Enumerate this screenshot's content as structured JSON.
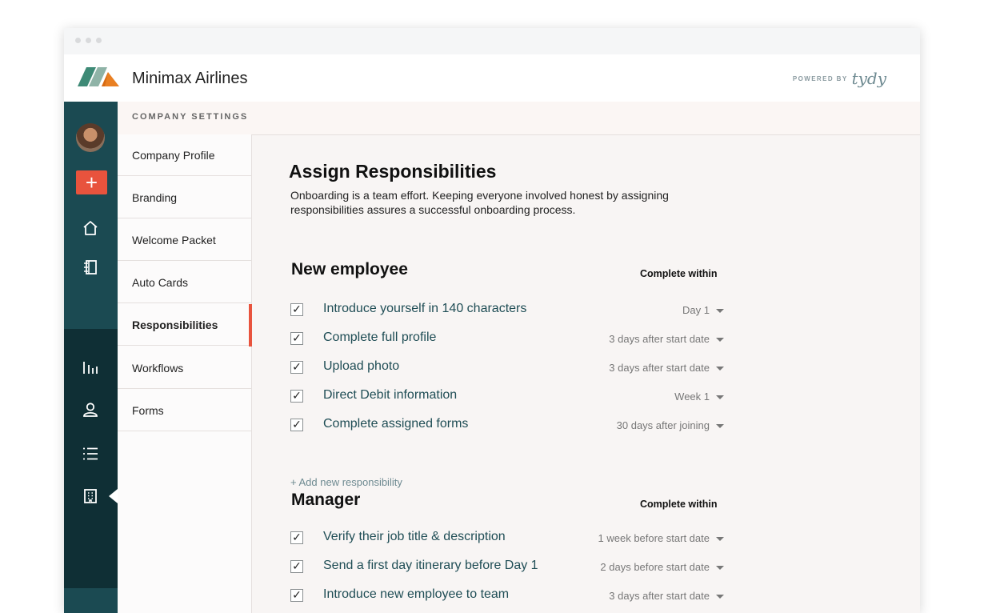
{
  "app": {
    "brand": "Minimax Airlines",
    "powered_by": "POWERED BY",
    "powered_logo": "tydy"
  },
  "colors": {
    "rail_dark": "#0f2f35",
    "rail_teal": "#1b4a52",
    "accent": "#e8533d",
    "task_text": "#1f4d55"
  },
  "rail": {
    "icons": [
      "avatar",
      "plus-icon",
      "home-icon",
      "book-icon",
      "bar-chart-icon",
      "user-icon",
      "list-icon",
      "building-icon"
    ],
    "add_label": "+"
  },
  "settings": {
    "title": "COMPANY SETTINGS",
    "items": [
      {
        "label": "Company Profile"
      },
      {
        "label": "Branding"
      },
      {
        "label": "Welcome Packet"
      },
      {
        "label": "Auto Cards"
      },
      {
        "label": "Responsibilities",
        "active": true
      },
      {
        "label": "Workflows"
      },
      {
        "label": "Forms"
      }
    ]
  },
  "main": {
    "title": "Assign Responsibilities",
    "description": "Onboarding is a team effort. Keeping everyone involved honest by assigning responsibilities assures a successful onboarding process.",
    "add_link": "+ Add new responsibility",
    "sections": [
      {
        "title": "New employee",
        "column_label": "Complete within",
        "rows": [
          {
            "task": "Introduce yourself in 140 characters",
            "when": "Day 1",
            "checked": true
          },
          {
            "task": "Complete full profile",
            "when": "3 days after start date",
            "checked": true
          },
          {
            "task": "Upload photo",
            "when": "3 days after start date",
            "checked": true
          },
          {
            "task": "Direct Debit information",
            "when": "Week 1",
            "checked": true
          },
          {
            "task": "Complete assigned forms",
            "when": "30 days after joining",
            "checked": true
          }
        ]
      },
      {
        "title": "Manager",
        "column_label": "Complete within",
        "rows": [
          {
            "task": "Verify their job title & description",
            "when": "1 week before start date",
            "checked": true
          },
          {
            "task": "Send a first day itinerary before Day 1",
            "when": "2 days before start date",
            "checked": true
          },
          {
            "task": "Introduce new employee to team",
            "when": "3 days after start date",
            "checked": true
          }
        ]
      }
    ]
  },
  "check_glyph": "✓"
}
